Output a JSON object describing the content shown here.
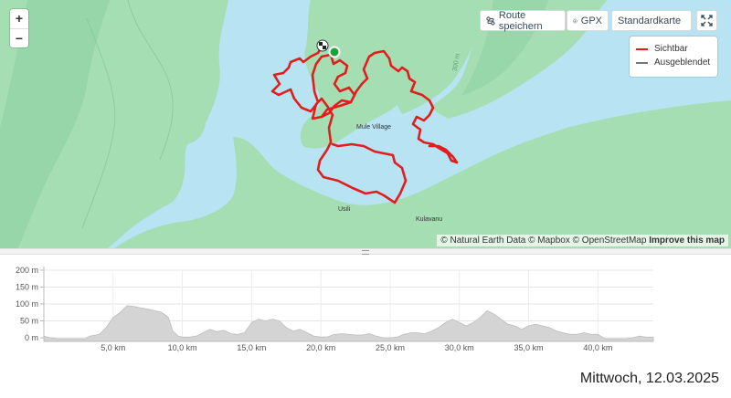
{
  "map": {
    "zoom_in": "+",
    "zoom_out": "−",
    "buttons": {
      "save_route": "Route speichern",
      "gpx": "GPX",
      "map_style": "Standardkarte"
    },
    "legend": [
      {
        "label": "Sichtbar",
        "color": "#e01e1e"
      },
      {
        "label": "Ausgeblendet",
        "color": "#777777"
      }
    ],
    "places": {
      "village": "Mule Village",
      "south": "Usili",
      "southeast": "Kulavanu",
      "contour": "300 m"
    },
    "attribution": {
      "prefix": "© Natural Earth Data © Mapbox © OpenStreetMap",
      "improve": "Improve this map"
    },
    "colors": {
      "water": "#b7e3f3",
      "land": "#9fddb0",
      "route": "#e01e1e",
      "start": "#1aa33a"
    }
  },
  "chart_data": {
    "type": "area",
    "xlabel": "",
    "ylabel": "",
    "xlim": [
      0,
      44
    ],
    "ylim": [
      0,
      200
    ],
    "y_ticks": [
      "0 m",
      "50 m",
      "100 m",
      "150 m",
      "200 m"
    ],
    "y_tick_values": [
      0,
      50,
      100,
      150,
      200
    ],
    "x_ticks": [
      "5,0 km",
      "10,0 km",
      "15,0 km",
      "20,0 km",
      "25,0 km",
      "30,0 km",
      "35,0 km",
      "40,0 km"
    ],
    "x_tick_values": [
      5,
      10,
      15,
      20,
      25,
      30,
      35,
      40
    ],
    "grid": true,
    "x": [
      0,
      0.5,
      1,
      2,
      3,
      3.3,
      4,
      4.5,
      5,
      5.5,
      6,
      6.5,
      7,
      7.5,
      8,
      8.5,
      9,
      9.3,
      9.7,
      10,
      10.5,
      11,
      11.5,
      12,
      12.5,
      13,
      13.5,
      14,
      14.5,
      15,
      15.5,
      16,
      16.5,
      17,
      17.5,
      18,
      18.5,
      19,
      19.5,
      20,
      20.5,
      21,
      21.5,
      22,
      22.5,
      23,
      23.5,
      24,
      24.5,
      25,
      25.5,
      26,
      26.5,
      27,
      27.5,
      28,
      28.5,
      29,
      29.5,
      30,
      30.5,
      31,
      31.5,
      32,
      32.5,
      33,
      33.5,
      34,
      34.5,
      35,
      35.5,
      36,
      36.5,
      37,
      37.5,
      38,
      38.5,
      39,
      39.5,
      40,
      40.5,
      41,
      41.5,
      42,
      42.5,
      43,
      43.5,
      44
    ],
    "values": [
      5,
      0,
      -3,
      -3,
      -3,
      5,
      10,
      30,
      60,
      75,
      95,
      93,
      88,
      85,
      80,
      75,
      60,
      20,
      5,
      2,
      2,
      5,
      15,
      25,
      18,
      22,
      12,
      10,
      15,
      45,
      55,
      50,
      55,
      50,
      30,
      20,
      25,
      15,
      5,
      2,
      3,
      10,
      12,
      10,
      8,
      8,
      12,
      5,
      0,
      0,
      2,
      10,
      15,
      15,
      12,
      20,
      30,
      45,
      55,
      45,
      35,
      45,
      60,
      80,
      70,
      55,
      40,
      35,
      25,
      35,
      40,
      35,
      30,
      20,
      15,
      10,
      10,
      15,
      10,
      10,
      -3,
      -3,
      -3,
      -3,
      0,
      5,
      2,
      2
    ]
  },
  "footer": {
    "date": "Mittwoch, 12.03.2025"
  }
}
